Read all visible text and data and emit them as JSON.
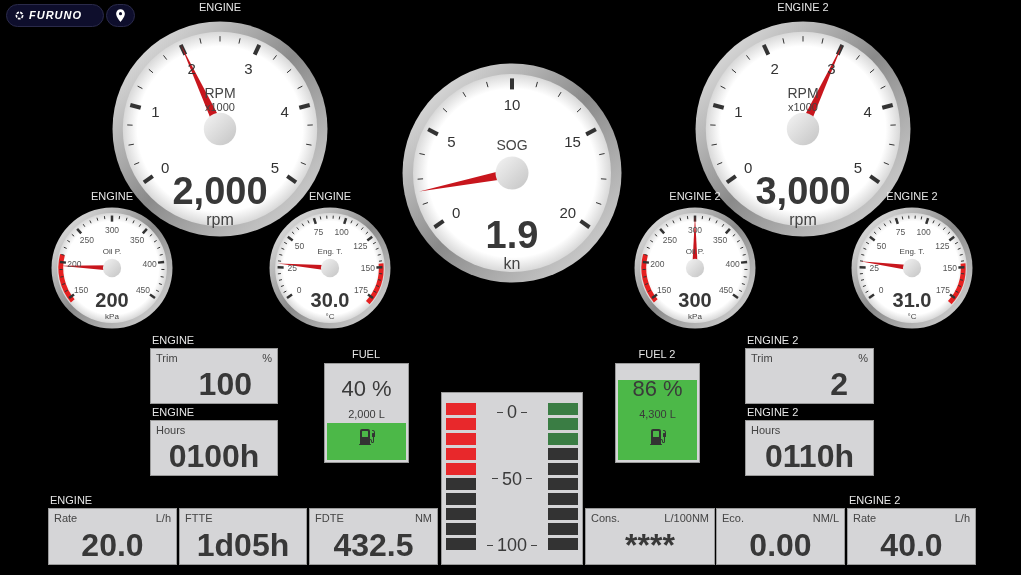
{
  "header": {
    "logo": "FURUNO"
  },
  "gauges": [
    {
      "title": "ENGINE",
      "kind": "rpm",
      "label": "RPM",
      "sublabel": "x1000",
      "scale": [
        "0",
        "1",
        "2",
        "3",
        "4",
        "5"
      ],
      "value": "2,000",
      "unit": "rpm",
      "level": 0.4
    },
    {
      "title": "ENGINE",
      "kind": "pressure",
      "label": "Oil P.",
      "scale": [
        "150",
        "200",
        "250",
        "300",
        "350",
        "400",
        "450"
      ],
      "value": "200",
      "unit": "kPa",
      "level": 0.15
    },
    {
      "title": "ENGINE",
      "kind": "temperature",
      "label": "Eng. T.",
      "scale": [
        "0",
        "25",
        "50",
        "75",
        "100",
        "125",
        "150",
        "175"
      ],
      "value": "30.0",
      "unit": "°C",
      "level": 0.16
    },
    {
      "kind": "speed",
      "label": "SOG",
      "scale": [
        "0",
        "5",
        "10",
        "15",
        "20"
      ],
      "value": "1.9",
      "unit": "kn",
      "level": 0.095
    },
    {
      "title": "ENGINE 2",
      "kind": "rpm",
      "label": "RPM",
      "sublabel": "x1000",
      "scale": [
        "0",
        "1",
        "2",
        "3",
        "4",
        "5"
      ],
      "value": "3,000",
      "unit": "rpm",
      "level": 0.6
    },
    {
      "title": "ENGINE 2",
      "kind": "pressure",
      "label": "Oil P.",
      "scale": [
        "150",
        "200",
        "250",
        "300",
        "350",
        "400",
        "450"
      ],
      "value": "300",
      "unit": "kPa",
      "level": 0.5
    },
    {
      "title": "ENGINE 2",
      "kind": "temperature",
      "label": "Eng. T.",
      "scale": [
        "0",
        "25",
        "50",
        "75",
        "100",
        "125",
        "150",
        "175"
      ],
      "value": "31.0",
      "unit": "°C",
      "level": 0.17
    }
  ],
  "boxes": [
    {
      "title": "ENGINE",
      "label": "Trim",
      "unit": "%",
      "value": "100"
    },
    {
      "title": "ENGINE",
      "label": "Hours",
      "value": "0100h"
    },
    {
      "title": "ENGINE 2",
      "label": "Trim",
      "unit": "%",
      "value": "2"
    },
    {
      "title": "ENGINE 2",
      "label": "Hours",
      "value": "0110h"
    },
    {
      "title": "ENGINE",
      "label": "Rate",
      "unit": "L/h",
      "value": "20.0"
    },
    {
      "label": "FTTE",
      "value": "1d05h"
    },
    {
      "label": "FDTE",
      "unit": "NM",
      "value": "432.5"
    },
    {
      "label": "Cons.",
      "unit": "L/100NM",
      "value": "****"
    },
    {
      "label": "Eco.",
      "unit": "NM/L",
      "value": "0.00"
    },
    {
      "title": "ENGINE 2",
      "label": "Rate",
      "unit": "L/h",
      "value": "40.0"
    }
  ],
  "tanks": [
    {
      "title": "FUEL",
      "percent": "40 %",
      "volume": "2,000 L",
      "level": 0.4
    },
    {
      "title": "FUEL 2",
      "percent": "86 %",
      "volume": "4,300 L",
      "level": 0.86
    }
  ],
  "bar_meter": {
    "scale": [
      "0",
      "50",
      "100"
    ],
    "columns": [
      {
        "color": "#e8282b",
        "level": 0.5
      },
      {
        "color": "#3a7d44",
        "level": 0.3
      }
    ]
  }
}
